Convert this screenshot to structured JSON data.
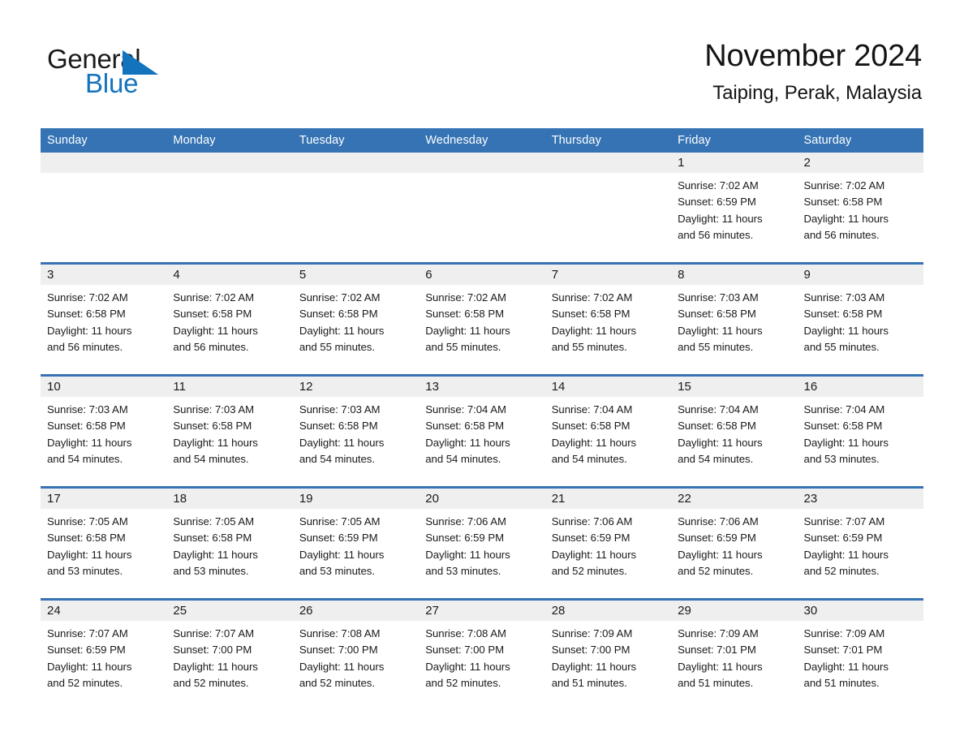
{
  "brand": {
    "name_part1": "General",
    "name_part2": "Blue",
    "accent_color": "#1473bd"
  },
  "header": {
    "title": "November 2024",
    "subtitle": "Taiping, Perak, Malaysia"
  },
  "calendar": {
    "header_bg": "#3573b4",
    "daynum_bg": "#efefef",
    "weekday_names": [
      "Sunday",
      "Monday",
      "Tuesday",
      "Wednesday",
      "Thursday",
      "Friday",
      "Saturday"
    ],
    "weeks": [
      [
        {
          "day": "",
          "lines": []
        },
        {
          "day": "",
          "lines": []
        },
        {
          "day": "",
          "lines": []
        },
        {
          "day": "",
          "lines": []
        },
        {
          "day": "",
          "lines": []
        },
        {
          "day": "1",
          "lines": [
            "Sunrise: 7:02 AM",
            "Sunset: 6:59 PM",
            "Daylight: 11 hours",
            "and 56 minutes."
          ]
        },
        {
          "day": "2",
          "lines": [
            "Sunrise: 7:02 AM",
            "Sunset: 6:58 PM",
            "Daylight: 11 hours",
            "and 56 minutes."
          ]
        }
      ],
      [
        {
          "day": "3",
          "lines": [
            "Sunrise: 7:02 AM",
            "Sunset: 6:58 PM",
            "Daylight: 11 hours",
            "and 56 minutes."
          ]
        },
        {
          "day": "4",
          "lines": [
            "Sunrise: 7:02 AM",
            "Sunset: 6:58 PM",
            "Daylight: 11 hours",
            "and 56 minutes."
          ]
        },
        {
          "day": "5",
          "lines": [
            "Sunrise: 7:02 AM",
            "Sunset: 6:58 PM",
            "Daylight: 11 hours",
            "and 55 minutes."
          ]
        },
        {
          "day": "6",
          "lines": [
            "Sunrise: 7:02 AM",
            "Sunset: 6:58 PM",
            "Daylight: 11 hours",
            "and 55 minutes."
          ]
        },
        {
          "day": "7",
          "lines": [
            "Sunrise: 7:02 AM",
            "Sunset: 6:58 PM",
            "Daylight: 11 hours",
            "and 55 minutes."
          ]
        },
        {
          "day": "8",
          "lines": [
            "Sunrise: 7:03 AM",
            "Sunset: 6:58 PM",
            "Daylight: 11 hours",
            "and 55 minutes."
          ]
        },
        {
          "day": "9",
          "lines": [
            "Sunrise: 7:03 AM",
            "Sunset: 6:58 PM",
            "Daylight: 11 hours",
            "and 55 minutes."
          ]
        }
      ],
      [
        {
          "day": "10",
          "lines": [
            "Sunrise: 7:03 AM",
            "Sunset: 6:58 PM",
            "Daylight: 11 hours",
            "and 54 minutes."
          ]
        },
        {
          "day": "11",
          "lines": [
            "Sunrise: 7:03 AM",
            "Sunset: 6:58 PM",
            "Daylight: 11 hours",
            "and 54 minutes."
          ]
        },
        {
          "day": "12",
          "lines": [
            "Sunrise: 7:03 AM",
            "Sunset: 6:58 PM",
            "Daylight: 11 hours",
            "and 54 minutes."
          ]
        },
        {
          "day": "13",
          "lines": [
            "Sunrise: 7:04 AM",
            "Sunset: 6:58 PM",
            "Daylight: 11 hours",
            "and 54 minutes."
          ]
        },
        {
          "day": "14",
          "lines": [
            "Sunrise: 7:04 AM",
            "Sunset: 6:58 PM",
            "Daylight: 11 hours",
            "and 54 minutes."
          ]
        },
        {
          "day": "15",
          "lines": [
            "Sunrise: 7:04 AM",
            "Sunset: 6:58 PM",
            "Daylight: 11 hours",
            "and 54 minutes."
          ]
        },
        {
          "day": "16",
          "lines": [
            "Sunrise: 7:04 AM",
            "Sunset: 6:58 PM",
            "Daylight: 11 hours",
            "and 53 minutes."
          ]
        }
      ],
      [
        {
          "day": "17",
          "lines": [
            "Sunrise: 7:05 AM",
            "Sunset: 6:58 PM",
            "Daylight: 11 hours",
            "and 53 minutes."
          ]
        },
        {
          "day": "18",
          "lines": [
            "Sunrise: 7:05 AM",
            "Sunset: 6:58 PM",
            "Daylight: 11 hours",
            "and 53 minutes."
          ]
        },
        {
          "day": "19",
          "lines": [
            "Sunrise: 7:05 AM",
            "Sunset: 6:59 PM",
            "Daylight: 11 hours",
            "and 53 minutes."
          ]
        },
        {
          "day": "20",
          "lines": [
            "Sunrise: 7:06 AM",
            "Sunset: 6:59 PM",
            "Daylight: 11 hours",
            "and 53 minutes."
          ]
        },
        {
          "day": "21",
          "lines": [
            "Sunrise: 7:06 AM",
            "Sunset: 6:59 PM",
            "Daylight: 11 hours",
            "and 52 minutes."
          ]
        },
        {
          "day": "22",
          "lines": [
            "Sunrise: 7:06 AM",
            "Sunset: 6:59 PM",
            "Daylight: 11 hours",
            "and 52 minutes."
          ]
        },
        {
          "day": "23",
          "lines": [
            "Sunrise: 7:07 AM",
            "Sunset: 6:59 PM",
            "Daylight: 11 hours",
            "and 52 minutes."
          ]
        }
      ],
      [
        {
          "day": "24",
          "lines": [
            "Sunrise: 7:07 AM",
            "Sunset: 6:59 PM",
            "Daylight: 11 hours",
            "and 52 minutes."
          ]
        },
        {
          "day": "25",
          "lines": [
            "Sunrise: 7:07 AM",
            "Sunset: 7:00 PM",
            "Daylight: 11 hours",
            "and 52 minutes."
          ]
        },
        {
          "day": "26",
          "lines": [
            "Sunrise: 7:08 AM",
            "Sunset: 7:00 PM",
            "Daylight: 11 hours",
            "and 52 minutes."
          ]
        },
        {
          "day": "27",
          "lines": [
            "Sunrise: 7:08 AM",
            "Sunset: 7:00 PM",
            "Daylight: 11 hours",
            "and 52 minutes."
          ]
        },
        {
          "day": "28",
          "lines": [
            "Sunrise: 7:09 AM",
            "Sunset: 7:00 PM",
            "Daylight: 11 hours",
            "and 51 minutes."
          ]
        },
        {
          "day": "29",
          "lines": [
            "Sunrise: 7:09 AM",
            "Sunset: 7:01 PM",
            "Daylight: 11 hours",
            "and 51 minutes."
          ]
        },
        {
          "day": "30",
          "lines": [
            "Sunrise: 7:09 AM",
            "Sunset: 7:01 PM",
            "Daylight: 11 hours",
            "and 51 minutes."
          ]
        }
      ]
    ]
  }
}
